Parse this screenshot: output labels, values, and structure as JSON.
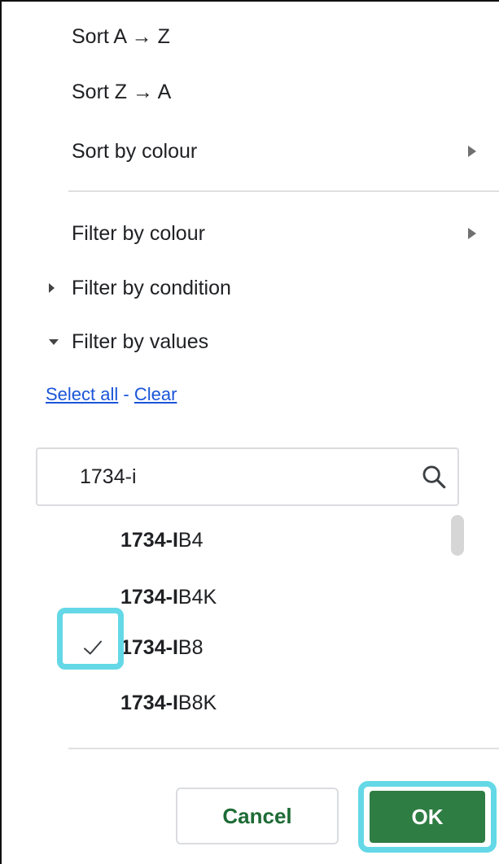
{
  "sort_menu": {
    "sort_a_z": "Sort A → Z",
    "sort_z_a": "Sort Z → A",
    "sort_by_colour": "Sort by colour"
  },
  "filter_menu": {
    "filter_by_colour": "Filter by colour",
    "filter_by_condition": "Filter by condition",
    "filter_by_values": "Filter by values"
  },
  "values_panel": {
    "select_all": "Select all",
    "separator": "-",
    "clear": "Clear",
    "search_value": "1734-i",
    "items": [
      {
        "match": "1734-I",
        "rest": "B4",
        "checked": false
      },
      {
        "match": "1734-I",
        "rest": "B4K",
        "checked": false
      },
      {
        "match": "1734-I",
        "rest": "B8",
        "checked": true
      },
      {
        "match": "1734-I",
        "rest": "B8K",
        "checked": false
      }
    ]
  },
  "footer": {
    "cancel_label": "Cancel",
    "ok_label": "OK"
  },
  "colors": {
    "highlight": "#64d8e6",
    "ok_button": "#2e7d43",
    "cancel_text": "#1e6b35",
    "link": "#1a55d8"
  },
  "icons": {
    "submenu": "arrow-right-icon",
    "search": "search-icon",
    "checkmark": "check-icon"
  }
}
